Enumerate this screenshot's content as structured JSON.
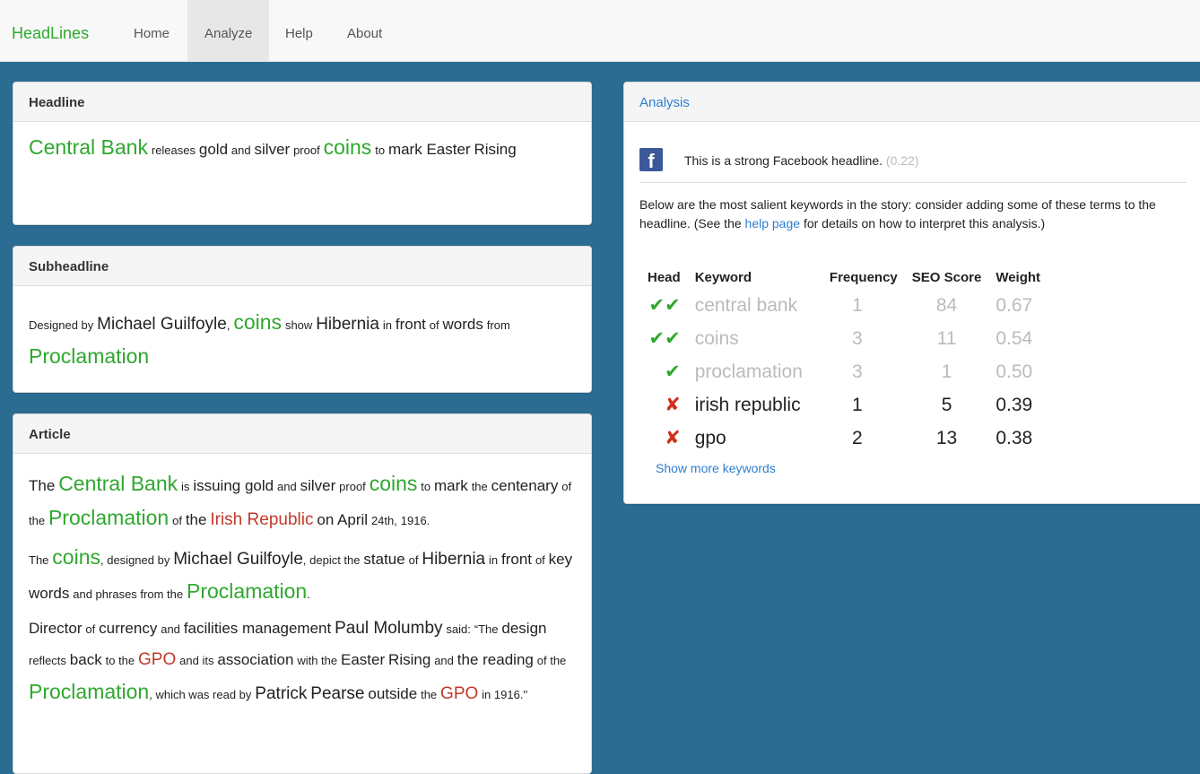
{
  "nav": {
    "brand": "HeadLines",
    "items": [
      "Home",
      "Analyze",
      "Help",
      "About"
    ],
    "active": "Analyze"
  },
  "headline_panel": {
    "title": "Headline"
  },
  "subheadline_panel": {
    "title": "Subheadline"
  },
  "article_panel": {
    "title": "Article"
  },
  "analysis": {
    "title": "Analysis",
    "facebook_text": "This is a strong Facebook headline.",
    "facebook_score": "(0.22)",
    "desc_part1": "Below are the most salient keywords in the story: consider adding some of these terms to the headline. (See the",
    "desc_link": "help page",
    "desc_part2": "for details on how to interpret this analysis.)",
    "columns": [
      "Head",
      "Keyword",
      "Frequency",
      "SEO Score",
      "Weight"
    ],
    "rows": [
      {
        "head": "✔✔",
        "keyword": "central bank",
        "frequency": "1",
        "seo": "84",
        "weight": "0.67"
      },
      {
        "head": "✔✔",
        "keyword": "coins",
        "frequency": "3",
        "seo": "11",
        "weight": "0.54"
      },
      {
        "head": "✔",
        "keyword": "proclamation",
        "frequency": "3",
        "seo": "1",
        "weight": "0.50"
      },
      {
        "head": "✘",
        "keyword": "irish republic",
        "frequency": "1",
        "seo": "5",
        "weight": "0.39"
      },
      {
        "head": "✘",
        "keyword": "gpo",
        "frequency": "2",
        "seo": "13",
        "weight": "0.38"
      }
    ],
    "show_more": "Show more keywords"
  },
  "colors": {
    "background": "#2b6c93",
    "keyword_green": "#2ea82e",
    "keyword_red": "#c0392b",
    "link_blue": "#2d7fcf"
  },
  "text": {
    "h1": "Central Bank",
    "h2": "releases",
    "h3": "gold",
    "h4": "and",
    "h5": "silver",
    "h6": "proof",
    "h7": "coins",
    "h8": "to",
    "h9": "mark Easter",
    "h10": "Rising",
    "s1": "Designed by",
    "s2": "Michael Guilfoyle",
    "s3": ",",
    "s4": "coins",
    "s5": "show",
    "s6": "Hibernia",
    "s7": "in",
    "s8": "front",
    "s9": "of",
    "s10": "words",
    "s11": "from",
    "s12": "Proclamation",
    "p1a": "The",
    "p1b": "Central Bank",
    "p1c": "is",
    "p1d": "issuing gold",
    "p1e": "and",
    "p1f": "silver",
    "p1g": "proof",
    "p1h": "coins",
    "p1i": "to",
    "p1j": "mark",
    "p1k": "the",
    "p1l": "centenary",
    "p1m": "of the",
    "p1n": "Proclamation",
    "p1o": "of",
    "p1p": "the",
    "p1q": "Irish Republic",
    "p1r": "on April",
    "p1s": "24th,",
    "p1t": "1916.",
    "p2a": "The",
    "p2b": "coins",
    "p2c": ", designed by",
    "p2d": "Michael Guilfoyle",
    "p2e": ", depict the",
    "p2f": "statue",
    "p2g": "of",
    "p2h": "Hibernia",
    "p2i": "in",
    "p2j": "front",
    "p2k": "of",
    "p2l": "key words",
    "p2m": "and phrases from the",
    "p2n": "Proclamation",
    "p2o": ".",
    "p3a": "Director",
    "p3b": "of",
    "p3c": "currency",
    "p3d": "and",
    "p3e": "facilities management",
    "p3f": "Paul Molumby",
    "p3g": "said:",
    "p3h": "“The",
    "p3i": "design",
    "p3j": "reflects",
    "p3k": "back",
    "p3l": "to the",
    "p3m": "GPO",
    "p3n": "and its",
    "p3o": "association",
    "p3p": "with the",
    "p3q": "Easter",
    "p3r": "Rising",
    "p3s": "and",
    "p3t": "the reading",
    "p3u": "of the",
    "p3v": "Proclamation",
    "p3w": ", which was read by",
    "p3x": "Patrick",
    "p3y": "Pearse",
    "p3z": "outside",
    "p3aa": "the",
    "p3ab": "GPO",
    "p3ac": "in 1916.''"
  }
}
